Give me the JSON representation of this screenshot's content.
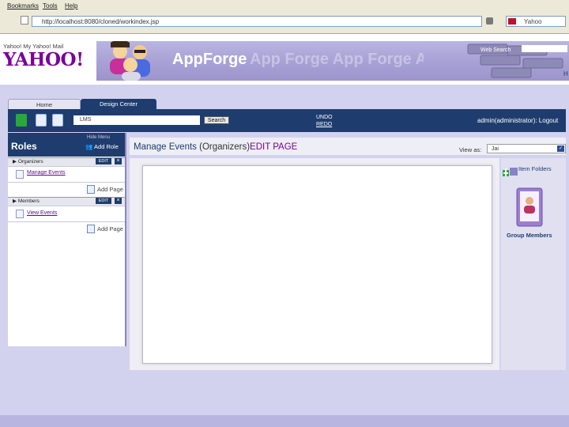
{
  "browser": {
    "menus": [
      "Bookmarks",
      "Tools",
      "Help"
    ],
    "url": "http://localhost:8080/cloned/workindex.jsp",
    "search_placeholder": "Yahoo"
  },
  "yahoo": {
    "links": "Yahoo! My Yahoo! Mail",
    "logo": "YAHOO!",
    "web_search_label": "Web Search"
  },
  "banner": {
    "title": "AppForge",
    "ghost": "App Forge App Forge App"
  },
  "tabs": [
    "Home",
    "Design Center"
  ],
  "toolbar": {
    "select_value": "LMS",
    "search_button": "Search",
    "undo": "UNDO",
    "redo": "REDO",
    "user_text": "admin(administrator): Logout"
  },
  "roles": {
    "hide_menu": "Hide Menu",
    "title": "Roles",
    "add_role": "Add Role",
    "groups": [
      {
        "name": "Organizers",
        "edit": "EDIT",
        "close": "×",
        "page": "Manage Events",
        "add_page": "Add Page"
      },
      {
        "name": "Members",
        "edit": "EDIT",
        "close": "×",
        "page": "View Events",
        "add_page": "Add Page"
      }
    ]
  },
  "main": {
    "title_prefix": "Manage Events",
    "title_group": "(Organizers)",
    "title_suffix": "EDIT PAGE",
    "view_as_label": "View as:",
    "view_as_value": "Jai"
  },
  "right_panel": {
    "item_folders": "Item Folders",
    "group_members": "Group Members"
  },
  "colors": {
    "navy": "#1e3d6e",
    "lavender": "#d3d2ee",
    "yahoo_purple": "#7b0099",
    "link_purple": "#5a0c85"
  }
}
